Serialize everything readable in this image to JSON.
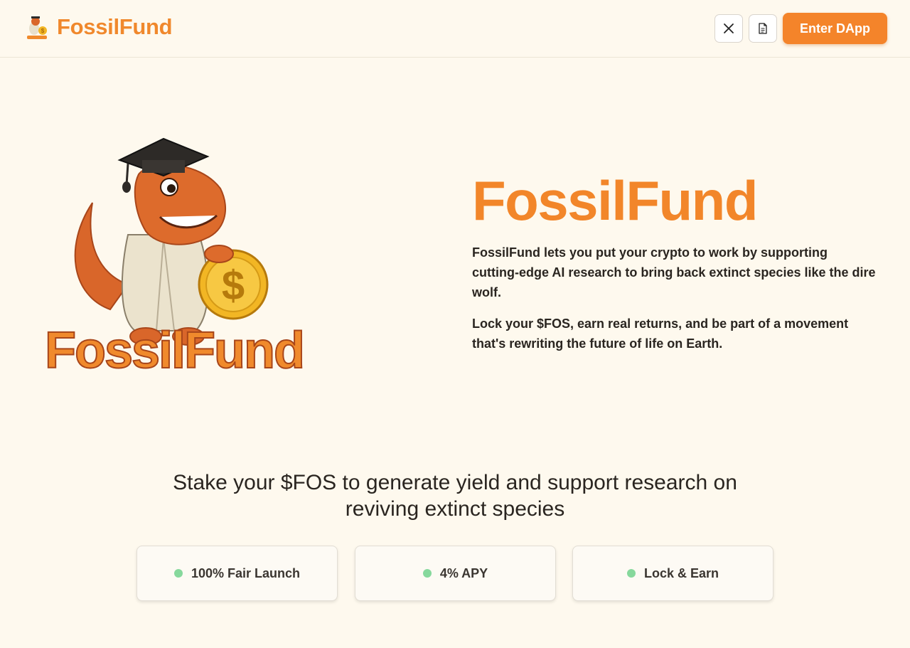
{
  "header": {
    "brand_name": "FossilFund",
    "logo_icon": "dino-logo-icon",
    "twitter_icon": "x-twitter-icon",
    "docs_icon": "document-icon",
    "cta_label": "Enter DApp"
  },
  "hero": {
    "title": "FossilFund",
    "paragraph1": "FossilFund lets you put your crypto to work by supporting cutting-edge AI research to bring back extinct species like the dire wolf.",
    "paragraph2": "Lock your $FOS, earn real returns, and be part of a movement that's rewriting the future of life on Earth.",
    "art_wordmark": "FossilFund",
    "art_coin_symbol": "$"
  },
  "stake": {
    "heading": "Stake your $FOS to generate yield and support research on reviving extinct species",
    "features": [
      {
        "label": "100% Fair Launch"
      },
      {
        "label": "4% APY"
      },
      {
        "label": "Lock & Earn"
      }
    ]
  },
  "colors": {
    "brand_orange": "#f2862a",
    "background": "#fef9ee",
    "dot_green": "#86d89c",
    "text": "#2a2520"
  }
}
